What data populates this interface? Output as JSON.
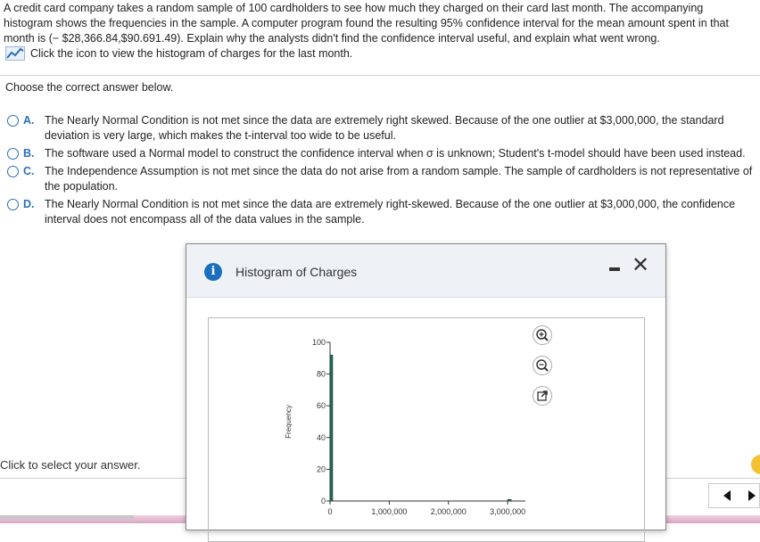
{
  "question": {
    "text": "A credit card company takes a random sample of 100 cardholders to see how much they charged on their card last month. The accompanying histogram shows the frequencies in the sample. A computer program found the resulting 95% confidence interval for the mean amount spent in that month is (− $28,366.84,$90.691.49). Explain why the analysts didn't find the confidence interval useful, and explain what went wrong.",
    "link_text": "Click the icon to view the histogram of charges for the last month."
  },
  "prompt": "Choose the correct answer below.",
  "options": [
    {
      "letter": "A.",
      "text": "The Nearly Normal Condition is not met since the data are extremely right skewed. Because of the one outlier at $3,000,000, the standard deviation is very large, which makes the t-interval too wide to be useful."
    },
    {
      "letter": "B.",
      "text": "The software used a Normal model to construct the confidence interval when σ is unknown; Student's t-model should have been used instead."
    },
    {
      "letter": "C.",
      "text": "The Independence Assumption is not met since the data do not arise from a random sample. The sample of cardholders is not representative of the population."
    },
    {
      "letter": "D.",
      "text": "The Nearly Normal Condition is not met since the data are extremely right-skewed. Because of the one outlier at $3,000,000, the confidence interval does not encompass all of the data values in the sample."
    }
  ],
  "footer": {
    "select_hint": "Click to select your answer."
  },
  "dialog": {
    "title": "Histogram of Charges",
    "info_glyph": "i",
    "close_glyph": "✕"
  },
  "icons": {
    "chart_link": "line-chart-icon",
    "zoom_in": "zoom-in-icon",
    "zoom_out": "zoom-out-icon",
    "popout": "popout-icon"
  },
  "colors": {
    "accent": "#2b6fb6",
    "bar": "#1f6b5c",
    "info": "#1c6fbf"
  },
  "chart_data": {
    "type": "bar",
    "ylabel": "Frequency",
    "xlabel": "",
    "ylim": [
      0,
      100
    ],
    "xlim": [
      0,
      3300000
    ],
    "y_ticks": [
      "0",
      "20",
      "40",
      "60",
      "80",
      "100"
    ],
    "x_ticks": [
      {
        "value": 0,
        "label": "0"
      },
      {
        "value": 1000000,
        "label": "1,000,000"
      },
      {
        "value": 2000000,
        "label": "2,000,000"
      },
      {
        "value": 3000000,
        "label": "3,000,000"
      }
    ],
    "bins": [
      {
        "start": 0,
        "end": 40000,
        "count": 92
      },
      {
        "start": 3000000,
        "end": 3060000,
        "count": 1
      }
    ],
    "grid": false
  }
}
